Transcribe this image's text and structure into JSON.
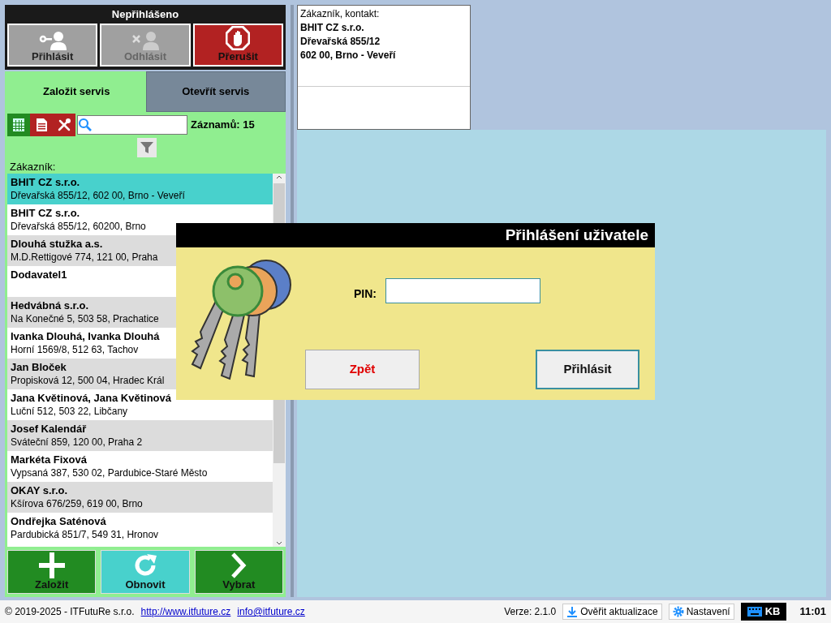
{
  "header": {
    "title": "Nepřihlášeno",
    "buttons": [
      {
        "label": "Přihlásit",
        "kind": "neutral",
        "disabled": false
      },
      {
        "label": "Odhlásit",
        "kind": "neutral",
        "disabled": true
      },
      {
        "label": "Přerušit",
        "kind": "danger",
        "disabled": false
      }
    ]
  },
  "tabs": [
    {
      "label": "Založit servis",
      "selected": true
    },
    {
      "label": "Otevřít servis",
      "selected": false
    }
  ],
  "toolbar": {
    "records": "Záznamů: 15"
  },
  "list": {
    "label": "Zákazník:",
    "rows": [
      {
        "name": "BHIT CZ s.r.o.",
        "address": "Dřevařská 855/12, 602 00, Brno - Veveří",
        "selected": true
      },
      {
        "name": "BHIT CZ s.r.o.",
        "address": "Dřevařská 855/12, 60200, Brno",
        "selected": false
      },
      {
        "name": "Dlouhá stužka a.s.",
        "address": "M.D.Rettigové 774, 121 00, Praha",
        "selected": false
      },
      {
        "name": "Dodavatel1",
        "selected": false
      },
      {
        "name": "Hedvábná s.r.o.",
        "address": "Na Konečné 5, 503 58, Prachatice",
        "selected": false
      },
      {
        "name": "Ivanka Dlouhá, Ivanka Dlouhá",
        "address": "Horní 1569/8, 512 63, Tachov",
        "selected": false
      },
      {
        "name": "Jan Bloček",
        "address": "Propisková 12, 500 04, Hradec Král",
        "selected": false
      },
      {
        "name": "Jana Květinová, Jana Květinová",
        "address": "Luční 512, 503 22, Libčany",
        "selected": false
      },
      {
        "name": "Josef Kalendář",
        "address": "Sváteční 859, 120 00, Praha 2",
        "selected": false
      },
      {
        "name": "Markéta Fixová",
        "address": "Vypsaná 387, 530 02, Pardubice-Staré Město",
        "selected": false
      },
      {
        "name": "OKAY s.r.o.",
        "address": "Kšírova 676/259, 619 00, Brno",
        "selected": false
      },
      {
        "name": "Ondřejka Saténová",
        "address": "Pardubická 851/7, 549 31, Hronov",
        "selected": false
      }
    ]
  },
  "actions": [
    {
      "label": "Založit",
      "kind": "primary"
    },
    {
      "label": "Obnovit",
      "kind": "secondary"
    },
    {
      "label": "Vybrat",
      "kind": "primary"
    }
  ],
  "contact": {
    "label": "Zákazník, kontakt:",
    "lines": [
      "BHIT CZ s.r.o.",
      "Dřevařská 855/12",
      "602 00, Brno - Veveří"
    ]
  },
  "dialog": {
    "title": "Přihlášení uživatele",
    "pin_label": "PIN:",
    "buttons": [
      {
        "label": "Zpět",
        "kind": "cancel"
      },
      {
        "label": "Přihlásit",
        "kind": "confirm"
      }
    ]
  },
  "status_bar": {
    "copyright": "© 2019-2025 - ITFutuRe s.r.o.",
    "links": [
      "http://www.itfuture.cz",
      "info@itfuture.cz"
    ],
    "version": "Verze: 2.1.0",
    "update": "Ověřit aktualizace",
    "settings": "Nastavení",
    "keyboard": "KB",
    "time": "11:01"
  }
}
